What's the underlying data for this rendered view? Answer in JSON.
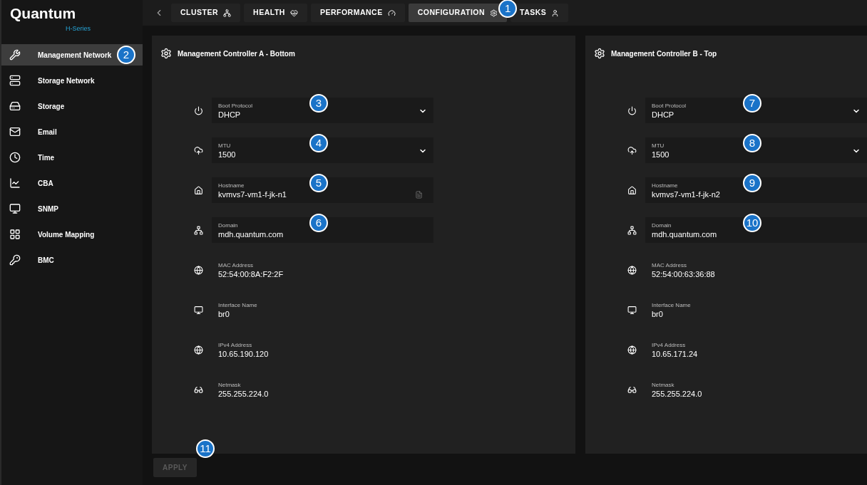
{
  "logo": {
    "name": "Quantum",
    "subtitle": "H-Series"
  },
  "tabs": [
    {
      "label": "CLUSTER",
      "selected": false
    },
    {
      "label": "HEALTH",
      "selected": false
    },
    {
      "label": "PERFORMANCE",
      "selected": false
    },
    {
      "label": "CONFIGURATION",
      "selected": true,
      "callout": "1"
    },
    {
      "label": "TASKS",
      "selected": false
    }
  ],
  "sidebar": {
    "items": [
      {
        "label": "Management Network",
        "selected": true,
        "callout": "2"
      },
      {
        "label": "Storage Network",
        "selected": false
      },
      {
        "label": "Storage",
        "selected": false
      },
      {
        "label": "Email",
        "selected": false
      },
      {
        "label": "Time",
        "selected": false
      },
      {
        "label": "CBA",
        "selected": false
      },
      {
        "label": "SNMP",
        "selected": false
      },
      {
        "label": "Volume Mapping",
        "selected": false
      },
      {
        "label": "BMC",
        "selected": false
      }
    ]
  },
  "panels": [
    {
      "title": "Management Controller A - Bottom",
      "fields": [
        {
          "kind": "select",
          "label": "Boot Protocol",
          "value": "DHCP",
          "callout": "3"
        },
        {
          "kind": "select",
          "label": "MTU",
          "value": "1500",
          "callout": "4"
        },
        {
          "kind": "input_action",
          "label": "Hostname",
          "value": "kvmvs7-vm1-f-jk-n1",
          "callout": "5"
        },
        {
          "kind": "input",
          "label": "Domain",
          "value": "mdh.quantum.com",
          "callout": "6"
        },
        {
          "kind": "readonly",
          "label": "MAC Address",
          "value": "52:54:00:8A:F2:2F"
        },
        {
          "kind": "readonly",
          "label": "Interface Name",
          "value": "br0"
        },
        {
          "kind": "readonly",
          "label": "IPv4 Address",
          "value": "10.65.190.120"
        },
        {
          "kind": "readonly",
          "label": "Netmask",
          "value": "255.255.224.0"
        }
      ]
    },
    {
      "title": "Management Controller B - Top",
      "fields": [
        {
          "kind": "select",
          "label": "Boot Protocol",
          "value": "DHCP",
          "callout": "7"
        },
        {
          "kind": "select",
          "label": "MTU",
          "value": "1500",
          "callout": "8"
        },
        {
          "kind": "input",
          "label": "Hostname",
          "value": "kvmvs7-vm1-f-jk-n2",
          "callout": "9"
        },
        {
          "kind": "input",
          "label": "Domain",
          "value": "mdh.quantum.com",
          "callout": "10"
        },
        {
          "kind": "readonly",
          "label": "MAC Address",
          "value": "52:54:00:63:36:88"
        },
        {
          "kind": "readonly",
          "label": "Interface Name",
          "value": "br0"
        },
        {
          "kind": "readonly",
          "label": "IPv4 Address",
          "value": "10.65.171.24"
        },
        {
          "kind": "readonly",
          "label": "Netmask",
          "value": "255.255.224.0"
        }
      ]
    }
  ],
  "apply": {
    "label": "APPLY",
    "disabled": true,
    "callout": "11"
  }
}
